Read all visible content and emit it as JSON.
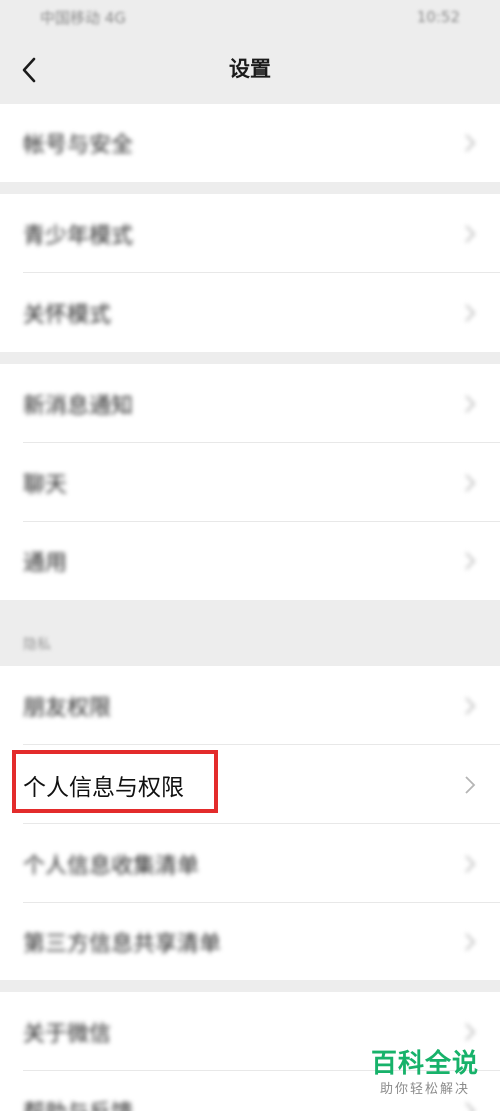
{
  "status_bar": {
    "carrier": "中国移动 4G",
    "time": "10:52"
  },
  "nav": {
    "title": "设置",
    "back_icon": "chevron-left-icon"
  },
  "groups": [
    {
      "items": [
        {
          "label": "帐号与安全"
        }
      ]
    },
    {
      "items": [
        {
          "label": "青少年模式"
        },
        {
          "label": "关怀模式"
        }
      ]
    },
    {
      "items": [
        {
          "label": "新消息通知"
        },
        {
          "label": "聊天"
        },
        {
          "label": "通用"
        }
      ]
    }
  ],
  "privacy": {
    "header": "隐私",
    "items": [
      {
        "label": "朋友权限"
      },
      {
        "label": "个人信息与权限"
      },
      {
        "label": "个人信息收集清单"
      },
      {
        "label": "第三方信息共享清单"
      }
    ]
  },
  "bottom_group": {
    "items": [
      {
        "label": "关于微信"
      },
      {
        "label": "帮助与反馈"
      }
    ]
  },
  "highlight": {
    "color": "#e32b2b"
  },
  "watermark": {
    "title": "百科全说",
    "subtitle": "助你轻松解决",
    "color": "#17b26a"
  }
}
